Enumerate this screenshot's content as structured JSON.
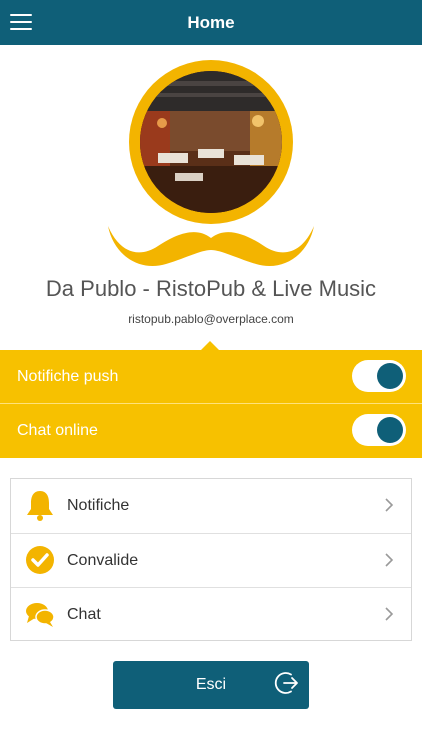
{
  "header": {
    "title": "Home",
    "menu_icon": "hamburger-icon"
  },
  "profile": {
    "name": "Da Publo - RistoPub & Live Music",
    "email": "ristopub.pablo@overplace.com"
  },
  "toggles": [
    {
      "label": "Notifiche push",
      "on": true
    },
    {
      "label": "Chat online",
      "on": true
    }
  ],
  "menu": [
    {
      "label": "Notifiche",
      "icon": "bell-icon"
    },
    {
      "label": "Convalide",
      "icon": "check-circle-icon"
    },
    {
      "label": "Chat",
      "icon": "chat-bubbles-icon"
    }
  ],
  "logout": {
    "label": "Esci",
    "icon": "logout-icon"
  },
  "colors": {
    "primary": "#0f5f78",
    "accent": "#f7c100"
  }
}
